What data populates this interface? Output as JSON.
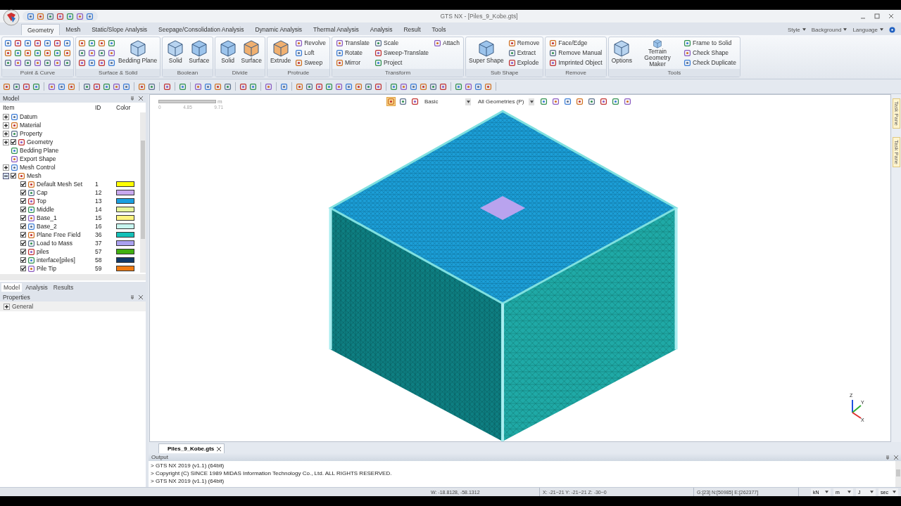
{
  "window": {
    "title": "GTS NX - [Piles_9_Kobe.gts]"
  },
  "ribbon_tabs": [
    {
      "label": "Geometry",
      "selected": true
    },
    {
      "label": "Mesh",
      "selected": false
    },
    {
      "label": "Static/Slope Analysis",
      "selected": false
    },
    {
      "label": "Seepage/Consolidation Analysis",
      "selected": false
    },
    {
      "label": "Dynamic Analysis",
      "selected": false
    },
    {
      "label": "Thermal Analysis",
      "selected": false
    },
    {
      "label": "Analysis",
      "selected": false
    },
    {
      "label": "Result",
      "selected": false
    },
    {
      "label": "Tools",
      "selected": false
    }
  ],
  "ribbon_menus": [
    "Style",
    "Background",
    "Language"
  ],
  "ribbon_groups": [
    {
      "title": "Point & Curve",
      "items": [
        {
          "kind": "icon-column"
        },
        {
          "kind": "icon-column"
        },
        {
          "kind": "icon-column"
        },
        {
          "kind": "icon-column"
        },
        {
          "kind": "icon-column"
        },
        {
          "kind": "icon-column"
        },
        {
          "kind": "icon-column"
        }
      ]
    },
    {
      "title": "Surface & Solid",
      "items": [
        {
          "kind": "icon-column"
        },
        {
          "kind": "icon-column"
        },
        {
          "kind": "icon-column"
        },
        {
          "kind": "icon-column"
        },
        {
          "kind": "large",
          "label": "Bedding Plane"
        }
      ]
    },
    {
      "title": "Boolean",
      "items": [
        {
          "kind": "large",
          "label": "Solid"
        },
        {
          "kind": "large",
          "label": "Surface"
        }
      ]
    },
    {
      "title": "Divide",
      "items": [
        {
          "kind": "large",
          "label": "Solid"
        },
        {
          "kind": "large",
          "label": "Surface"
        }
      ]
    },
    {
      "title": "Protrude",
      "items": [
        {
          "kind": "large",
          "label": "Extrude"
        },
        {
          "kind": "small",
          "label": "Revolve"
        },
        {
          "kind": "small",
          "label": "Loft"
        },
        {
          "kind": "small",
          "label": "Sweep"
        }
      ]
    },
    {
      "title": "Transform",
      "items": [
        {
          "kind": "small",
          "label": "Translate"
        },
        {
          "kind": "small",
          "label": "Rotate"
        },
        {
          "kind": "small",
          "label": "Mirror"
        },
        {
          "kind": "small",
          "label": "Scale"
        },
        {
          "kind": "small",
          "label": "Sweep-Translate"
        },
        {
          "kind": "small",
          "label": "Project"
        },
        {
          "kind": "small",
          "label": "Attach"
        }
      ]
    },
    {
      "title": "Sub Shape",
      "items": [
        {
          "kind": "large",
          "label": "Super Shape"
        },
        {
          "kind": "small",
          "label": "Remove"
        },
        {
          "kind": "small",
          "label": "Extract"
        },
        {
          "kind": "small",
          "label": "Explode"
        }
      ]
    },
    {
      "title": "Remove",
      "items": [
        {
          "kind": "small",
          "label": "Face/Edge"
        },
        {
          "kind": "small",
          "label": "Remove Manual"
        },
        {
          "kind": "small",
          "label": "Imprinted Object"
        }
      ]
    },
    {
      "title": "Tools",
      "items": [
        {
          "kind": "large",
          "label": "Options"
        },
        {
          "kind": "large",
          "label": "Terrain Geometry Maker"
        },
        {
          "kind": "small",
          "label": "Frame to Solid"
        },
        {
          "kind": "small",
          "label": "Check Shape"
        },
        {
          "kind": "small",
          "label": "Check Duplicate"
        }
      ]
    }
  ],
  "model_panel": {
    "title": "Model",
    "columns": [
      "Item",
      "ID",
      "Color"
    ],
    "tree": [
      {
        "label": "Datum",
        "expanded": false
      },
      {
        "label": "Material",
        "expanded": false
      },
      {
        "label": "Property",
        "expanded": false
      },
      {
        "label": "Geometry",
        "expanded": false,
        "checked": true
      },
      {
        "label": "Bedding Plane"
      },
      {
        "label": "Export Shape"
      },
      {
        "label": "Mesh Control",
        "expanded": false
      },
      {
        "label": "Mesh",
        "expanded": true,
        "checked": true,
        "children": [
          {
            "label": "Default Mesh Set",
            "id": "1",
            "color": "#ffff00",
            "checked": true
          },
          {
            "label": "Cap",
            "id": "12",
            "color": "#c8a8ee",
            "checked": true
          },
          {
            "label": "Top",
            "id": "13",
            "color": "#1a9fe0",
            "checked": true
          },
          {
            "label": "Middle",
            "id": "14",
            "color": "#e6f59a",
            "checked": true
          },
          {
            "label": "Base_1",
            "id": "15",
            "color": "#fff580",
            "checked": true
          },
          {
            "label": "Base_2",
            "id": "16",
            "color": "#c8f5ef",
            "checked": true
          },
          {
            "label": "Plane Free Field",
            "id": "36",
            "color": "#14c0b8",
            "checked": true
          },
          {
            "label": "Load to Mass",
            "id": "37",
            "color": "#aaa0f0",
            "checked": true
          },
          {
            "label": "piles",
            "id": "57",
            "color": "#40b010",
            "checked": true
          },
          {
            "label": "interface[piles]",
            "id": "58",
            "color": "#103868",
            "checked": true
          },
          {
            "label": "Pile Tip",
            "id": "59",
            "color": "#f07a10",
            "checked": true
          }
        ]
      }
    ],
    "tabs": [
      {
        "label": "Model",
        "selected": true
      },
      {
        "label": "Analysis",
        "selected": false
      },
      {
        "label": "Results",
        "selected": false
      }
    ]
  },
  "properties_panel": {
    "title": "Properties",
    "items": [
      {
        "label": "General",
        "expanded": false
      }
    ]
  },
  "viewport": {
    "scale_bar": {
      "labels": [
        "0",
        "4.85",
        "9.71"
      ],
      "unit": "m"
    },
    "display_mode": "Basic",
    "filter": "All Geometries (P)",
    "axes": [
      "Z",
      "Y",
      "X"
    ]
  },
  "task_pane": [
    "Task Pane",
    "Task Pane"
  ],
  "document_tabs": [
    {
      "label": "Piles_9_Kobe.gts",
      "selected": true
    }
  ],
  "output": {
    "title": "Output",
    "lines": [
      "> GTS NX 2019 (v1.1) (64bit)",
      "> Copyright (C) SINCE 1989 MIDAS Information Technology Co., Ltd. ALL RIGHTS RESERVED.",
      "> GTS NX 2019 (v1.1) (64bit)"
    ]
  },
  "status_bar": {
    "cursor": "W: -18.8128, -58.1312",
    "range": "X: -21~21 Y: -21~21 Z: -30~0",
    "counts": "G:[23] N:[50985] E:[262377]",
    "units": [
      "kN",
      "m",
      "J",
      "sec"
    ]
  }
}
